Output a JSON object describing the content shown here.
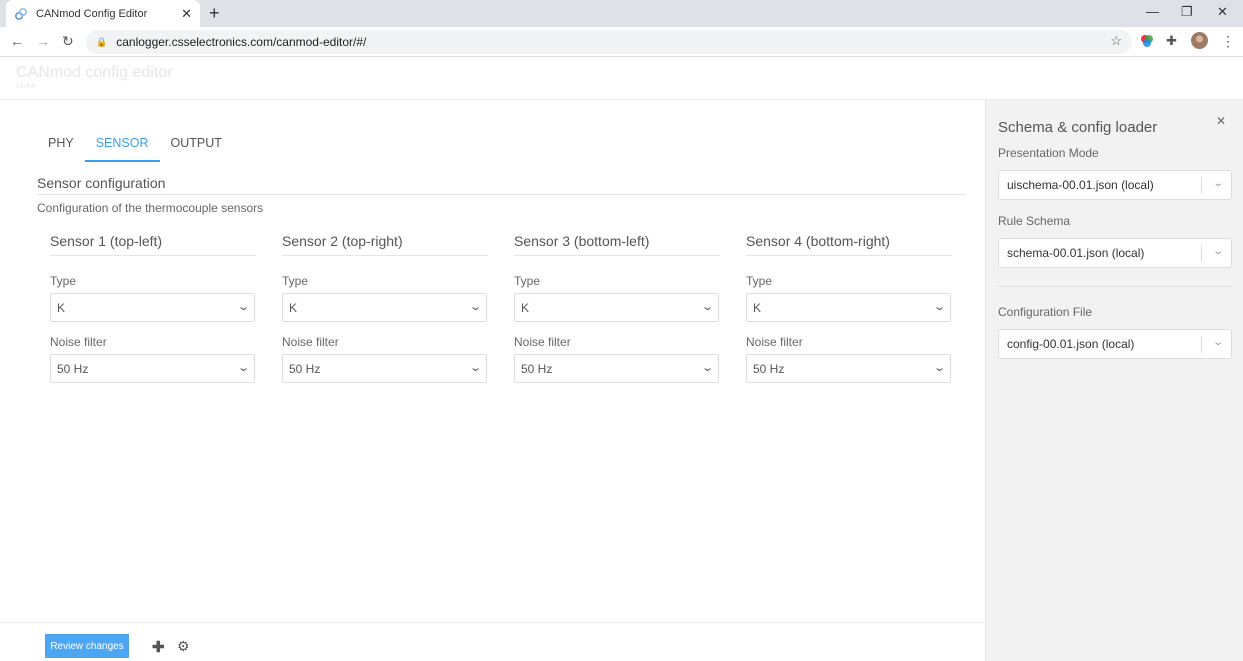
{
  "browser": {
    "tab_title": "CANmod Config Editor",
    "tab_close": "✕",
    "new_tab": "+",
    "url": "canlogger.csselectronics.com/canmod-editor/#/"
  },
  "app": {
    "title": "CANmod config editor",
    "version": "v1.4.4"
  },
  "tabs": [
    {
      "label": "PHY"
    },
    {
      "label": "SENSOR"
    },
    {
      "label": "OUTPUT"
    }
  ],
  "section": {
    "title": "Sensor configuration",
    "description": "Configuration of the thermocouple sensors"
  },
  "sensors": [
    {
      "name": "Sensor 1 (top-left)",
      "type_label": "Type",
      "type_value": "K",
      "filter_label": "Noise filter",
      "filter_value": "50 Hz"
    },
    {
      "name": "Sensor 2 (top-right)",
      "type_label": "Type",
      "type_value": "K",
      "filter_label": "Noise filter",
      "filter_value": "50 Hz"
    },
    {
      "name": "Sensor 3 (bottom-left)",
      "type_label": "Type",
      "type_value": "K",
      "filter_label": "Noise filter",
      "filter_value": "50 Hz"
    },
    {
      "name": "Sensor 4 (bottom-right)",
      "type_label": "Type",
      "type_value": "K",
      "filter_label": "Noise filter",
      "filter_value": "50 Hz"
    }
  ],
  "bottombar": {
    "review_label": "Review changes"
  },
  "sidebar": {
    "title": "Schema & config loader",
    "presentation_label": "Presentation Mode",
    "presentation_value": "uischema-00.01.json (local)",
    "rule_label": "Rule Schema",
    "rule_value": "schema-00.01.json (local)",
    "config_label": "Configuration File",
    "config_value": "config-00.01.json (local)"
  },
  "colors": {
    "accent": "#3d9df2",
    "button": "#4da6f3",
    "sidebar_bg": "#f2f2f2"
  }
}
